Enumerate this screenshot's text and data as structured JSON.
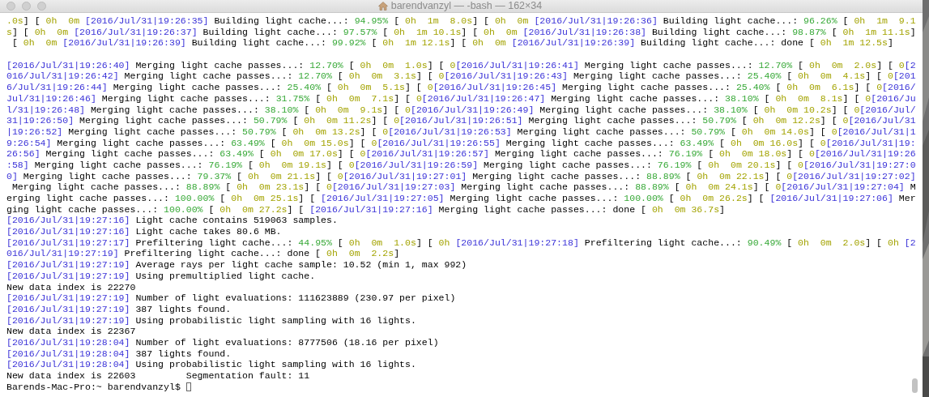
{
  "window": {
    "title": "barendvanzyl — -bash — 162×34"
  },
  "terminal": {
    "lines": [
      {
        "kind": "output",
        "segments": [
          {
            "kind": "elapsed",
            "text": ".0s"
          },
          {
            "kind": "plain",
            "text": "] [ "
          },
          {
            "kind": "elapsed",
            "text": "0h  0m "
          },
          {
            "kind": "timestamp",
            "text": "[2016/Jul/31|19:26:35]"
          },
          {
            "kind": "plain",
            "text": " Building light cache...: "
          },
          {
            "kind": "percent",
            "text": "94.95%"
          },
          {
            "kind": "plain",
            "text": " [ "
          },
          {
            "kind": "elapsed",
            "text": "0h  1m  8.0s"
          },
          {
            "kind": "plain",
            "text": "] [ "
          },
          {
            "kind": "elapsed",
            "text": "0h  0m "
          },
          {
            "kind": "timestamp",
            "text": "[2016/Jul/31|19:26:36]"
          },
          {
            "kind": "plain",
            "text": " Building light cache...: "
          },
          {
            "kind": "percent",
            "text": "96.26%"
          },
          {
            "kind": "plain",
            "text": " [ "
          },
          {
            "kind": "elapsed",
            "text": "0h  1m  9.1"
          }
        ]
      },
      {
        "kind": "output",
        "segments": [
          {
            "kind": "elapsed",
            "text": "s"
          },
          {
            "kind": "plain",
            "text": "] [ "
          },
          {
            "kind": "elapsed",
            "text": "0h  0m "
          },
          {
            "kind": "timestamp",
            "text": "[2016/Jul/31|19:26:37]"
          },
          {
            "kind": "plain",
            "text": " Building light cache...: "
          },
          {
            "kind": "percent",
            "text": "97.57%"
          },
          {
            "kind": "plain",
            "text": " [ "
          },
          {
            "kind": "elapsed",
            "text": "0h  1m 10.1s"
          },
          {
            "kind": "plain",
            "text": "] [ "
          },
          {
            "kind": "elapsed",
            "text": "0h  0m "
          },
          {
            "kind": "timestamp",
            "text": "[2016/Jul/31|19:26:38]"
          },
          {
            "kind": "plain",
            "text": " Building light cache...: "
          },
          {
            "kind": "percent",
            "text": "98.87%"
          },
          {
            "kind": "plain",
            "text": " [ "
          },
          {
            "kind": "elapsed",
            "text": "0h  1m 11.1s"
          },
          {
            "kind": "plain",
            "text": "]"
          }
        ]
      },
      {
        "kind": "output",
        "segments": [
          {
            "kind": "plain",
            "text": " [ "
          },
          {
            "kind": "elapsed",
            "text": "0h  0m "
          },
          {
            "kind": "timestamp",
            "text": "[2016/Jul/31|19:26:39]"
          },
          {
            "kind": "plain",
            "text": " Building light cache...: "
          },
          {
            "kind": "percent",
            "text": "99.92%"
          },
          {
            "kind": "plain",
            "text": " [ "
          },
          {
            "kind": "elapsed",
            "text": "0h  1m 12.1s"
          },
          {
            "kind": "plain",
            "text": "] [ "
          },
          {
            "kind": "elapsed",
            "text": "0h  0m "
          },
          {
            "kind": "timestamp",
            "text": "[2016/Jul/31|19:26:39]"
          },
          {
            "kind": "plain",
            "text": " Building light cache...: done [ "
          },
          {
            "kind": "elapsed",
            "text": "0h  1m 12.5s"
          },
          {
            "kind": "plain",
            "text": "]"
          }
        ]
      },
      {
        "kind": "blank"
      },
      {
        "kind": "output",
        "segments": [
          {
            "kind": "timestamp",
            "text": "[2016/Jul/31|19:26:40]"
          },
          {
            "kind": "plain",
            "text": " Merging light cache passes...: "
          },
          {
            "kind": "percent",
            "text": "12.70%"
          },
          {
            "kind": "plain",
            "text": " [ "
          },
          {
            "kind": "elapsed",
            "text": "0h  0m  1.0s"
          },
          {
            "kind": "plain",
            "text": "] [ "
          },
          {
            "kind": "elapsed",
            "text": "0"
          },
          {
            "kind": "timestamp",
            "text": "[2016/Jul/31|19:26:41]"
          },
          {
            "kind": "plain",
            "text": " Merging light cache passes...: "
          },
          {
            "kind": "percent",
            "text": "12.70%"
          },
          {
            "kind": "plain",
            "text": " [ "
          },
          {
            "kind": "elapsed",
            "text": "0h  0m  2.0s"
          },
          {
            "kind": "plain",
            "text": "] [ "
          },
          {
            "kind": "elapsed",
            "text": "0"
          },
          {
            "kind": "timestamp",
            "text": "[2"
          }
        ]
      },
      {
        "kind": "output",
        "segments": [
          {
            "kind": "timestamp",
            "text": "016/Jul/31|19:26:42]"
          },
          {
            "kind": "plain",
            "text": " Merging light cache passes...: "
          },
          {
            "kind": "percent",
            "text": "12.70%"
          },
          {
            "kind": "plain",
            "text": " [ "
          },
          {
            "kind": "elapsed",
            "text": "0h  0m  3.1s"
          },
          {
            "kind": "plain",
            "text": "] [ "
          },
          {
            "kind": "elapsed",
            "text": "0"
          },
          {
            "kind": "timestamp",
            "text": "[2016/Jul/31|19:26:43]"
          },
          {
            "kind": "plain",
            "text": " Merging light cache passes...: "
          },
          {
            "kind": "percent",
            "text": "25.40%"
          },
          {
            "kind": "plain",
            "text": " [ "
          },
          {
            "kind": "elapsed",
            "text": "0h  0m  4.1s"
          },
          {
            "kind": "plain",
            "text": "] [ "
          },
          {
            "kind": "elapsed",
            "text": "0"
          },
          {
            "kind": "timestamp",
            "text": "[201"
          }
        ]
      },
      {
        "kind": "output",
        "segments": [
          {
            "kind": "timestamp",
            "text": "6/Jul/31|19:26:44]"
          },
          {
            "kind": "plain",
            "text": " Merging light cache passes...: "
          },
          {
            "kind": "percent",
            "text": "25.40%"
          },
          {
            "kind": "plain",
            "text": " [ "
          },
          {
            "kind": "elapsed",
            "text": "0h  0m  5.1s"
          },
          {
            "kind": "plain",
            "text": "] [ "
          },
          {
            "kind": "elapsed",
            "text": "0"
          },
          {
            "kind": "timestamp",
            "text": "[2016/Jul/31|19:26:45]"
          },
          {
            "kind": "plain",
            "text": " Merging light cache passes...: "
          },
          {
            "kind": "percent",
            "text": "25.40%"
          },
          {
            "kind": "plain",
            "text": " [ "
          },
          {
            "kind": "elapsed",
            "text": "0h  0m  6.1s"
          },
          {
            "kind": "plain",
            "text": "] [ "
          },
          {
            "kind": "elapsed",
            "text": "0"
          },
          {
            "kind": "timestamp",
            "text": "[2016/"
          }
        ]
      },
      {
        "kind": "output",
        "segments": [
          {
            "kind": "timestamp",
            "text": "Jul/31|19:26:46]"
          },
          {
            "kind": "plain",
            "text": " Merging light cache passes...: "
          },
          {
            "kind": "percent",
            "text": "31.75%"
          },
          {
            "kind": "plain",
            "text": " [ "
          },
          {
            "kind": "elapsed",
            "text": "0h  0m  7.1s"
          },
          {
            "kind": "plain",
            "text": "] [ "
          },
          {
            "kind": "elapsed",
            "text": "0"
          },
          {
            "kind": "timestamp",
            "text": "[2016/Jul/31|19:26:47]"
          },
          {
            "kind": "plain",
            "text": " Merging light cache passes...: "
          },
          {
            "kind": "percent",
            "text": "38.10%"
          },
          {
            "kind": "plain",
            "text": " [ "
          },
          {
            "kind": "elapsed",
            "text": "0h  0m  8.1s"
          },
          {
            "kind": "plain",
            "text": "] [ "
          },
          {
            "kind": "elapsed",
            "text": "0"
          },
          {
            "kind": "timestamp",
            "text": "[2016/Ju"
          }
        ]
      },
      {
        "kind": "output",
        "segments": [
          {
            "kind": "timestamp",
            "text": "l/31|19:26:48]"
          },
          {
            "kind": "plain",
            "text": " Merging light cache passes...: "
          },
          {
            "kind": "percent",
            "text": "38.10%"
          },
          {
            "kind": "plain",
            "text": " [ "
          },
          {
            "kind": "elapsed",
            "text": "0h  0m  9.1s"
          },
          {
            "kind": "plain",
            "text": "] [ "
          },
          {
            "kind": "elapsed",
            "text": "0"
          },
          {
            "kind": "timestamp",
            "text": "[2016/Jul/31|19:26:49]"
          },
          {
            "kind": "plain",
            "text": " Merging light cache passes...: "
          },
          {
            "kind": "percent",
            "text": "38.10%"
          },
          {
            "kind": "plain",
            "text": " [ "
          },
          {
            "kind": "elapsed",
            "text": "0h  0m 10.2s"
          },
          {
            "kind": "plain",
            "text": "] [ "
          },
          {
            "kind": "elapsed",
            "text": "0"
          },
          {
            "kind": "timestamp",
            "text": "[2016/Jul/"
          }
        ]
      },
      {
        "kind": "output",
        "segments": [
          {
            "kind": "timestamp",
            "text": "31|19:26:50]"
          },
          {
            "kind": "plain",
            "text": " Merging light cache passes...: "
          },
          {
            "kind": "percent",
            "text": "50.79%"
          },
          {
            "kind": "plain",
            "text": " [ "
          },
          {
            "kind": "elapsed",
            "text": "0h  0m 11.2s"
          },
          {
            "kind": "plain",
            "text": "] [ "
          },
          {
            "kind": "elapsed",
            "text": "0"
          },
          {
            "kind": "timestamp",
            "text": "[2016/Jul/31|19:26:51]"
          },
          {
            "kind": "plain",
            "text": " Merging light cache passes...: "
          },
          {
            "kind": "percent",
            "text": "50.79%"
          },
          {
            "kind": "plain",
            "text": " [ "
          },
          {
            "kind": "elapsed",
            "text": "0h  0m 12.2s"
          },
          {
            "kind": "plain",
            "text": "] [ "
          },
          {
            "kind": "elapsed",
            "text": "0"
          },
          {
            "kind": "timestamp",
            "text": "[2016/Jul/31"
          }
        ]
      },
      {
        "kind": "output",
        "segments": [
          {
            "kind": "timestamp",
            "text": "|19:26:52]"
          },
          {
            "kind": "plain",
            "text": " Merging light cache passes...: "
          },
          {
            "kind": "percent",
            "text": "50.79%"
          },
          {
            "kind": "plain",
            "text": " [ "
          },
          {
            "kind": "elapsed",
            "text": "0h  0m 13.2s"
          },
          {
            "kind": "plain",
            "text": "] [ "
          },
          {
            "kind": "elapsed",
            "text": "0"
          },
          {
            "kind": "timestamp",
            "text": "[2016/Jul/31|19:26:53]"
          },
          {
            "kind": "plain",
            "text": " Merging light cache passes...: "
          },
          {
            "kind": "percent",
            "text": "50.79%"
          },
          {
            "kind": "plain",
            "text": " [ "
          },
          {
            "kind": "elapsed",
            "text": "0h  0m 14.0s"
          },
          {
            "kind": "plain",
            "text": "] [ "
          },
          {
            "kind": "elapsed",
            "text": "0"
          },
          {
            "kind": "timestamp",
            "text": "[2016/Jul/31|1"
          }
        ]
      },
      {
        "kind": "output",
        "segments": [
          {
            "kind": "timestamp",
            "text": "9:26:54]"
          },
          {
            "kind": "plain",
            "text": " Merging light cache passes...: "
          },
          {
            "kind": "percent",
            "text": "63.49%"
          },
          {
            "kind": "plain",
            "text": " [ "
          },
          {
            "kind": "elapsed",
            "text": "0h  0m 15.0s"
          },
          {
            "kind": "plain",
            "text": "] [ "
          },
          {
            "kind": "elapsed",
            "text": "0"
          },
          {
            "kind": "timestamp",
            "text": "[2016/Jul/31|19:26:55]"
          },
          {
            "kind": "plain",
            "text": " Merging light cache passes...: "
          },
          {
            "kind": "percent",
            "text": "63.49%"
          },
          {
            "kind": "plain",
            "text": " [ "
          },
          {
            "kind": "elapsed",
            "text": "0h  0m 16.0s"
          },
          {
            "kind": "plain",
            "text": "] [ "
          },
          {
            "kind": "elapsed",
            "text": "0"
          },
          {
            "kind": "timestamp",
            "text": "[2016/Jul/31|19:"
          }
        ]
      },
      {
        "kind": "output",
        "segments": [
          {
            "kind": "timestamp",
            "text": "26:56]"
          },
          {
            "kind": "plain",
            "text": " Merging light cache passes...: "
          },
          {
            "kind": "percent",
            "text": "63.49%"
          },
          {
            "kind": "plain",
            "text": " [ "
          },
          {
            "kind": "elapsed",
            "text": "0h  0m 17.0s"
          },
          {
            "kind": "plain",
            "text": "] [ "
          },
          {
            "kind": "elapsed",
            "text": "0"
          },
          {
            "kind": "timestamp",
            "text": "[2016/Jul/31|19:26:57]"
          },
          {
            "kind": "plain",
            "text": " Merging light cache passes...: "
          },
          {
            "kind": "percent",
            "text": "76.19%"
          },
          {
            "kind": "plain",
            "text": " [ "
          },
          {
            "kind": "elapsed",
            "text": "0h  0m 18.0s"
          },
          {
            "kind": "plain",
            "text": "] [ "
          },
          {
            "kind": "elapsed",
            "text": "0"
          },
          {
            "kind": "timestamp",
            "text": "[2016/Jul/31|19:26"
          }
        ]
      },
      {
        "kind": "output",
        "segments": [
          {
            "kind": "timestamp",
            "text": ":58]"
          },
          {
            "kind": "plain",
            "text": " Merging light cache passes...: "
          },
          {
            "kind": "percent",
            "text": "76.19%"
          },
          {
            "kind": "plain",
            "text": " [ "
          },
          {
            "kind": "elapsed",
            "text": "0h  0m 19.1s"
          },
          {
            "kind": "plain",
            "text": "] [ "
          },
          {
            "kind": "elapsed",
            "text": "0"
          },
          {
            "kind": "timestamp",
            "text": "[2016/Jul/31|19:26:59]"
          },
          {
            "kind": "plain",
            "text": " Merging light cache passes...: "
          },
          {
            "kind": "percent",
            "text": "76.19%"
          },
          {
            "kind": "plain",
            "text": " [ "
          },
          {
            "kind": "elapsed",
            "text": "0h  0m 20.1s"
          },
          {
            "kind": "plain",
            "text": "] [ "
          },
          {
            "kind": "elapsed",
            "text": "0"
          },
          {
            "kind": "timestamp",
            "text": "[2016/Jul/31|19:27:0"
          }
        ]
      },
      {
        "kind": "output",
        "segments": [
          {
            "kind": "timestamp",
            "text": "0]"
          },
          {
            "kind": "plain",
            "text": " Merging light cache passes...: "
          },
          {
            "kind": "percent",
            "text": "79.37%"
          },
          {
            "kind": "plain",
            "text": " [ "
          },
          {
            "kind": "elapsed",
            "text": "0h  0m 21.1s"
          },
          {
            "kind": "plain",
            "text": "] [ "
          },
          {
            "kind": "elapsed",
            "text": "0"
          },
          {
            "kind": "timestamp",
            "text": "[2016/Jul/31|19:27:01]"
          },
          {
            "kind": "plain",
            "text": " Merging light cache passes...: "
          },
          {
            "kind": "percent",
            "text": "88.89%"
          },
          {
            "kind": "plain",
            "text": " [ "
          },
          {
            "kind": "elapsed",
            "text": "0h  0m 22.1s"
          },
          {
            "kind": "plain",
            "text": "] [ "
          },
          {
            "kind": "elapsed",
            "text": "0"
          },
          {
            "kind": "timestamp",
            "text": "[2016/Jul/31|19:27:02]"
          }
        ]
      },
      {
        "kind": "output",
        "segments": [
          {
            "kind": "plain",
            "text": " Merging light cache passes...: "
          },
          {
            "kind": "percent",
            "text": "88.89%"
          },
          {
            "kind": "plain",
            "text": " [ "
          },
          {
            "kind": "elapsed",
            "text": "0h  0m 23.1s"
          },
          {
            "kind": "plain",
            "text": "] [ "
          },
          {
            "kind": "elapsed",
            "text": "0"
          },
          {
            "kind": "timestamp",
            "text": "[2016/Jul/31|19:27:03]"
          },
          {
            "kind": "plain",
            "text": " Merging light cache passes...: "
          },
          {
            "kind": "percent",
            "text": "88.89%"
          },
          {
            "kind": "plain",
            "text": " [ "
          },
          {
            "kind": "elapsed",
            "text": "0h  0m 24.1s"
          },
          {
            "kind": "plain",
            "text": "] [ "
          },
          {
            "kind": "elapsed",
            "text": "0"
          },
          {
            "kind": "timestamp",
            "text": "[2016/Jul/31|19:27:04]"
          },
          {
            "kind": "plain",
            "text": " M"
          }
        ]
      },
      {
        "kind": "output",
        "segments": [
          {
            "kind": "plain",
            "text": "erging light cache passes...: "
          },
          {
            "kind": "percent",
            "text": "100.00%"
          },
          {
            "kind": "plain",
            "text": " [ "
          },
          {
            "kind": "elapsed",
            "text": "0h  0m 25.1s"
          },
          {
            "kind": "plain",
            "text": "] [ "
          },
          {
            "kind": "timestamp",
            "text": "[2016/Jul/31|19:27:05]"
          },
          {
            "kind": "plain",
            "text": " Merging light cache passes...: "
          },
          {
            "kind": "percent",
            "text": "100.00%"
          },
          {
            "kind": "plain",
            "text": " [ "
          },
          {
            "kind": "elapsed",
            "text": "0h  0m 26.2s"
          },
          {
            "kind": "plain",
            "text": "] [ "
          },
          {
            "kind": "timestamp",
            "text": "[2016/Jul/31|19:27:06]"
          },
          {
            "kind": "plain",
            "text": " Mer"
          }
        ]
      },
      {
        "kind": "output",
        "segments": [
          {
            "kind": "plain",
            "text": "ging light cache passes...: "
          },
          {
            "kind": "percent",
            "text": "100.00%"
          },
          {
            "kind": "plain",
            "text": " [ "
          },
          {
            "kind": "elapsed",
            "text": "0h  0m 27.2s"
          },
          {
            "kind": "plain",
            "text": "] [ "
          },
          {
            "kind": "timestamp",
            "text": "[2016/Jul/31|19:27:16]"
          },
          {
            "kind": "plain",
            "text": " Merging light cache passes...: done [ "
          },
          {
            "kind": "elapsed",
            "text": "0h  0m 36.7s"
          },
          {
            "kind": "plain",
            "text": "]"
          }
        ]
      },
      {
        "kind": "output",
        "segments": [
          {
            "kind": "timestamp",
            "text": "[2016/Jul/31|19:27:16]"
          },
          {
            "kind": "plain",
            "text": " Light cache contains 519063 samples."
          }
        ]
      },
      {
        "kind": "output",
        "segments": [
          {
            "kind": "timestamp",
            "text": "[2016/Jul/31|19:27:16]"
          },
          {
            "kind": "plain",
            "text": " Light cache takes 80.6 MB."
          }
        ]
      },
      {
        "kind": "output",
        "segments": [
          {
            "kind": "timestamp",
            "text": "[2016/Jul/31|19:27:17]"
          },
          {
            "kind": "plain",
            "text": " Prefiltering light cache...: "
          },
          {
            "kind": "percent",
            "text": "44.95%"
          },
          {
            "kind": "plain",
            "text": " [ "
          },
          {
            "kind": "elapsed",
            "text": "0h  0m  1.0s"
          },
          {
            "kind": "plain",
            "text": "] [ "
          },
          {
            "kind": "elapsed",
            "text": "0h "
          },
          {
            "kind": "timestamp",
            "text": "[2016/Jul/31|19:27:18]"
          },
          {
            "kind": "plain",
            "text": " Prefiltering light cache...: "
          },
          {
            "kind": "percent",
            "text": "90.49%"
          },
          {
            "kind": "plain",
            "text": " [ "
          },
          {
            "kind": "elapsed",
            "text": "0h  0m  2.0s"
          },
          {
            "kind": "plain",
            "text": "] [ "
          },
          {
            "kind": "elapsed",
            "text": "0h "
          },
          {
            "kind": "timestamp",
            "text": "[2"
          }
        ]
      },
      {
        "kind": "output",
        "segments": [
          {
            "kind": "timestamp",
            "text": "016/Jul/31|19:27:19]"
          },
          {
            "kind": "plain",
            "text": " Prefiltering light cache...: done [ "
          },
          {
            "kind": "elapsed",
            "text": "0h  0m  2.2s"
          },
          {
            "kind": "plain",
            "text": "]"
          }
        ]
      },
      {
        "kind": "output",
        "segments": [
          {
            "kind": "timestamp",
            "text": "[2016/Jul/31|19:27:19]"
          },
          {
            "kind": "plain",
            "text": " Average rays per light cache sample: 10.52 (min 1, max 992)"
          }
        ]
      },
      {
        "kind": "output",
        "segments": [
          {
            "kind": "timestamp",
            "text": "[2016/Jul/31|19:27:19]"
          },
          {
            "kind": "plain",
            "text": " Using premultiplied light cache."
          }
        ]
      },
      {
        "kind": "output",
        "segments": [
          {
            "kind": "plain",
            "text": "New data index is 22270"
          }
        ]
      },
      {
        "kind": "output",
        "segments": [
          {
            "kind": "timestamp",
            "text": "[2016/Jul/31|19:27:19]"
          },
          {
            "kind": "plain",
            "text": " Number of light evaluations: 111623889 (230.97 per pixel)"
          }
        ]
      },
      {
        "kind": "output",
        "segments": [
          {
            "kind": "timestamp",
            "text": "[2016/Jul/31|19:27:19]"
          },
          {
            "kind": "plain",
            "text": " 387 lights found."
          }
        ]
      },
      {
        "kind": "output",
        "segments": [
          {
            "kind": "timestamp",
            "text": "[2016/Jul/31|19:27:19]"
          },
          {
            "kind": "plain",
            "text": " Using probabilistic light sampling with 16 lights."
          }
        ]
      },
      {
        "kind": "output",
        "segments": [
          {
            "kind": "plain",
            "text": "New data index is 22367"
          }
        ]
      },
      {
        "kind": "output",
        "segments": [
          {
            "kind": "timestamp",
            "text": "[2016/Jul/31|19:28:04]"
          },
          {
            "kind": "plain",
            "text": " Number of light evaluations: 8777506 (18.16 per pixel)"
          }
        ]
      },
      {
        "kind": "output",
        "segments": [
          {
            "kind": "timestamp",
            "text": "[2016/Jul/31|19:28:04]"
          },
          {
            "kind": "plain",
            "text": " 387 lights found."
          }
        ]
      },
      {
        "kind": "output",
        "segments": [
          {
            "kind": "timestamp",
            "text": "[2016/Jul/31|19:28:04]"
          },
          {
            "kind": "plain",
            "text": " Using probabilistic light sampling with 16 lights."
          }
        ]
      },
      {
        "kind": "output",
        "segments": [
          {
            "kind": "plain",
            "text": "New data index is 22603         Segmentation fault: 11"
          }
        ]
      },
      {
        "kind": "prompt",
        "segments": [
          {
            "kind": "plain",
            "text": "Barends-Mac-Pro:~ barendvanzyl$ "
          }
        ]
      }
    ]
  }
}
